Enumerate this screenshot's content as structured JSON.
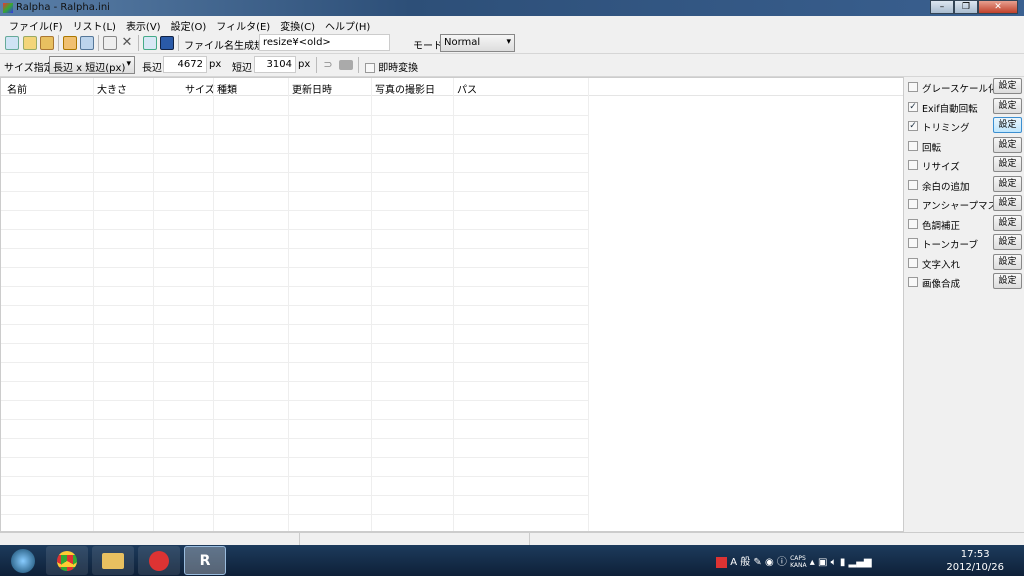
{
  "window": {
    "title": "Ralpha  - Ralpha.ini"
  },
  "menu": [
    "ファイル(F)",
    "リスト(L)",
    "表示(V)",
    "設定(O)",
    "フィルタ(E)",
    "変換(C)",
    "ヘルプ(H)"
  ],
  "toolbar": {
    "filename_rule_label": "ファイル名生成規則",
    "filename_rule_value": "resize¥<old>",
    "mode_label": "モード",
    "mode_value": "Normal"
  },
  "sizebar": {
    "size_label": "サイズ指定",
    "size_mode": "長辺 x 短辺(px)",
    "long_label": "長辺",
    "long_value": "4672",
    "long_unit": "px",
    "short_label": "短辺",
    "short_value": "3104",
    "short_unit": "px",
    "instant_label": "即時変換"
  },
  "columns": [
    "名前",
    "大きさ",
    "サイズ",
    "種類",
    "更新日時",
    "写真の撮影日",
    "パス"
  ],
  "filters": [
    {
      "label": "グレースケール化",
      "checked": false,
      "button": "設定"
    },
    {
      "label": "Exif自動回転",
      "checked": true,
      "button": "設定"
    },
    {
      "label": "トリミング",
      "checked": true,
      "button": "設定"
    },
    {
      "label": "回転",
      "checked": false,
      "button": "設定"
    },
    {
      "label": "リサイズ",
      "checked": false,
      "button": "設定"
    },
    {
      "label": "余白の追加",
      "checked": false,
      "button": "設定"
    },
    {
      "label": "アンシャープマスク",
      "checked": false,
      "button": "設定"
    },
    {
      "label": "色調補正",
      "checked": false,
      "button": "設定"
    },
    {
      "label": "トーンカーブ",
      "checked": false,
      "button": "設定"
    },
    {
      "label": "文字入れ",
      "checked": false,
      "button": "設定"
    },
    {
      "label": "画像合成",
      "checked": false,
      "button": "設定"
    }
  ],
  "taskbar": {
    "ime": "A 般",
    "caps": "CAPS",
    "kana": "KANA",
    "time": "17:53",
    "date": "2012/10/26"
  }
}
